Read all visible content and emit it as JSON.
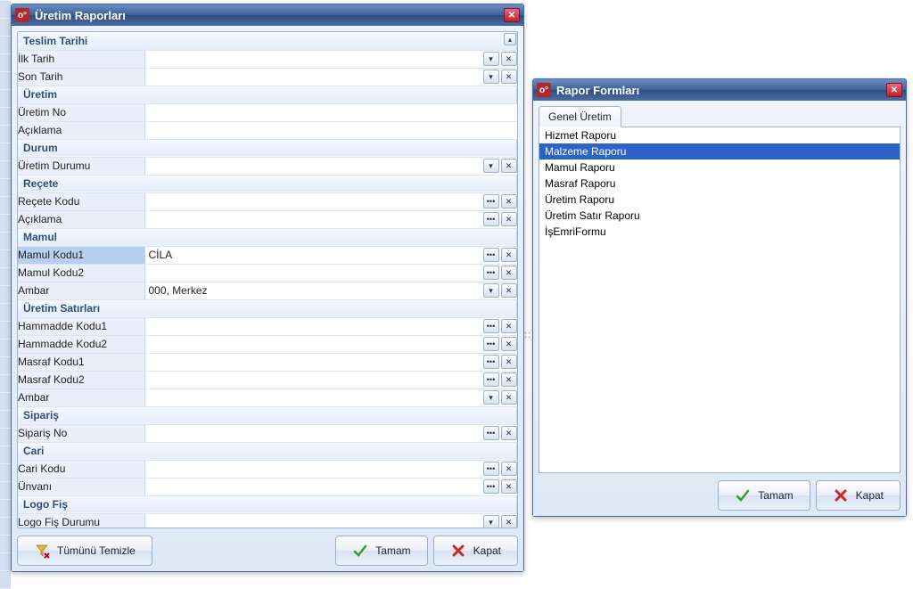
{
  "left_window": {
    "title": "Üretim Raporları",
    "sections": [
      {
        "header": "Teslim Tarihi",
        "rows": [
          {
            "label": "İlk Tarih",
            "value": "",
            "ctl": "dropdown"
          },
          {
            "label": "Son Tarih",
            "value": "",
            "ctl": "dropdown"
          }
        ]
      },
      {
        "header": "Üretim",
        "rows": [
          {
            "label": "Üretim No",
            "value": "",
            "ctl": "none"
          },
          {
            "label": "Açıklama",
            "value": "",
            "ctl": "none"
          }
        ]
      },
      {
        "header": "Durum",
        "rows": [
          {
            "label": "Üretim Durumu",
            "value": "",
            "ctl": "dropdown"
          }
        ]
      },
      {
        "header": "Reçete",
        "rows": [
          {
            "label": "Reçete Kodu",
            "value": "",
            "ctl": "lookup"
          },
          {
            "label": "Açıklama",
            "value": "",
            "ctl": "lookup"
          }
        ]
      },
      {
        "header": "Mamul",
        "rows": [
          {
            "label": "Mamul Kodu1",
            "value": "CİLA",
            "ctl": "lookup",
            "selected": true
          },
          {
            "label": "Mamul Kodu2",
            "value": "",
            "ctl": "lookup"
          },
          {
            "label": "Ambar",
            "value": "000, Merkez",
            "ctl": "dropdown"
          }
        ]
      },
      {
        "header": "Üretim Satırları",
        "rows": [
          {
            "label": "Hammadde Kodu1",
            "value": "",
            "ctl": "lookup"
          },
          {
            "label": "Hammadde Kodu2",
            "value": "",
            "ctl": "lookup"
          },
          {
            "label": "Masraf Kodu1",
            "value": "",
            "ctl": "lookup"
          },
          {
            "label": "Masraf Kodu2",
            "value": "",
            "ctl": "lookup"
          },
          {
            "label": "Ambar",
            "value": "",
            "ctl": "dropdown"
          }
        ]
      },
      {
        "header": "Sipariş",
        "rows": [
          {
            "label": "Sipariş No",
            "value": "",
            "ctl": "lookup"
          }
        ]
      },
      {
        "header": "Cari",
        "rows": [
          {
            "label": "Cari Kodu",
            "value": "",
            "ctl": "lookup"
          },
          {
            "label": "Ünvanı",
            "value": "",
            "ctl": "lookup"
          }
        ]
      },
      {
        "header": "Logo Fiş",
        "rows": [
          {
            "label": "Logo Fiş Durumu",
            "value": "",
            "ctl": "dropdown"
          }
        ]
      }
    ],
    "buttons": {
      "clear_all": "Tümünü Temizle",
      "ok": "Tamam",
      "close": "Kapat"
    }
  },
  "right_window": {
    "title": "Rapor Formları",
    "tab": "Genel Üretim",
    "items": [
      "Hizmet Raporu",
      "Malzeme Raporu",
      "Mamul Raporu",
      "Masraf Raporu",
      "Üretim Raporu",
      "Üretim Satır Raporu",
      "İşEmriFormu"
    ],
    "selected_index": 1,
    "buttons": {
      "ok": "Tamam",
      "close": "Kapat"
    }
  },
  "icons": {
    "app": "o°",
    "close_x": "✕",
    "dropdown": "▾",
    "lookup": "•••",
    "clear": "✕",
    "up": "▴"
  }
}
